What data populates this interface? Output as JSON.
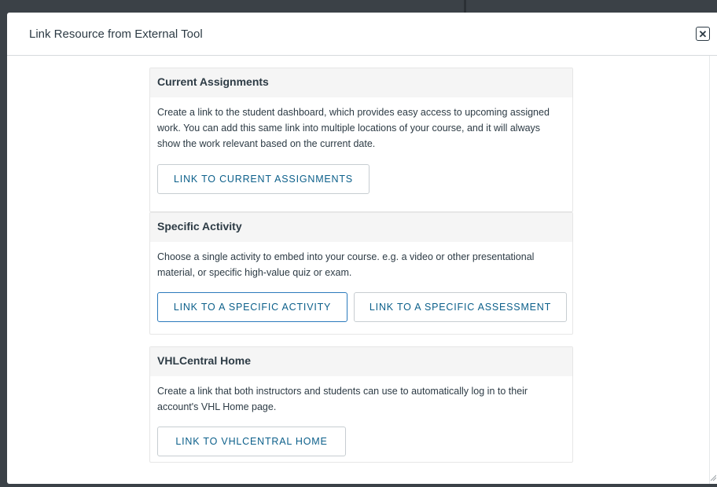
{
  "modal": {
    "title": "Link Resource from External Tool",
    "close_icon": "close-icon",
    "close_glyph": "✕"
  },
  "cards": [
    {
      "title": "Current Assignments",
      "description": "Create a link to the student dashboard, which provides easy access to upcoming assigned work. You can add this same link into multiple locations of your course, and it will always show the work relevant based on the current date.",
      "buttons": [
        "LINK TO CURRENT ASSIGNMENTS"
      ]
    },
    {
      "title": "Specific Activity",
      "description": "Choose a single activity to embed into your course. e.g. a video or other presentational material, or specific high-value quiz or exam.",
      "buttons": [
        "LINK TO A SPECIFIC ACTIVITY",
        "LINK TO A SPECIFIC ASSESSMENT"
      ]
    },
    {
      "title": "VHLCentral Home",
      "description": "Create a link that both instructors and students can use to automatically log in to their account's VHL Home page.",
      "buttons": [
        "LINK TO VHLCENTRAL HOME"
      ]
    }
  ],
  "colors": {
    "backdrop": "#3b4147",
    "button_text": "#0b5f8a",
    "focus_border": "#2b7abc",
    "card_header_bg": "#f5f5f5"
  }
}
